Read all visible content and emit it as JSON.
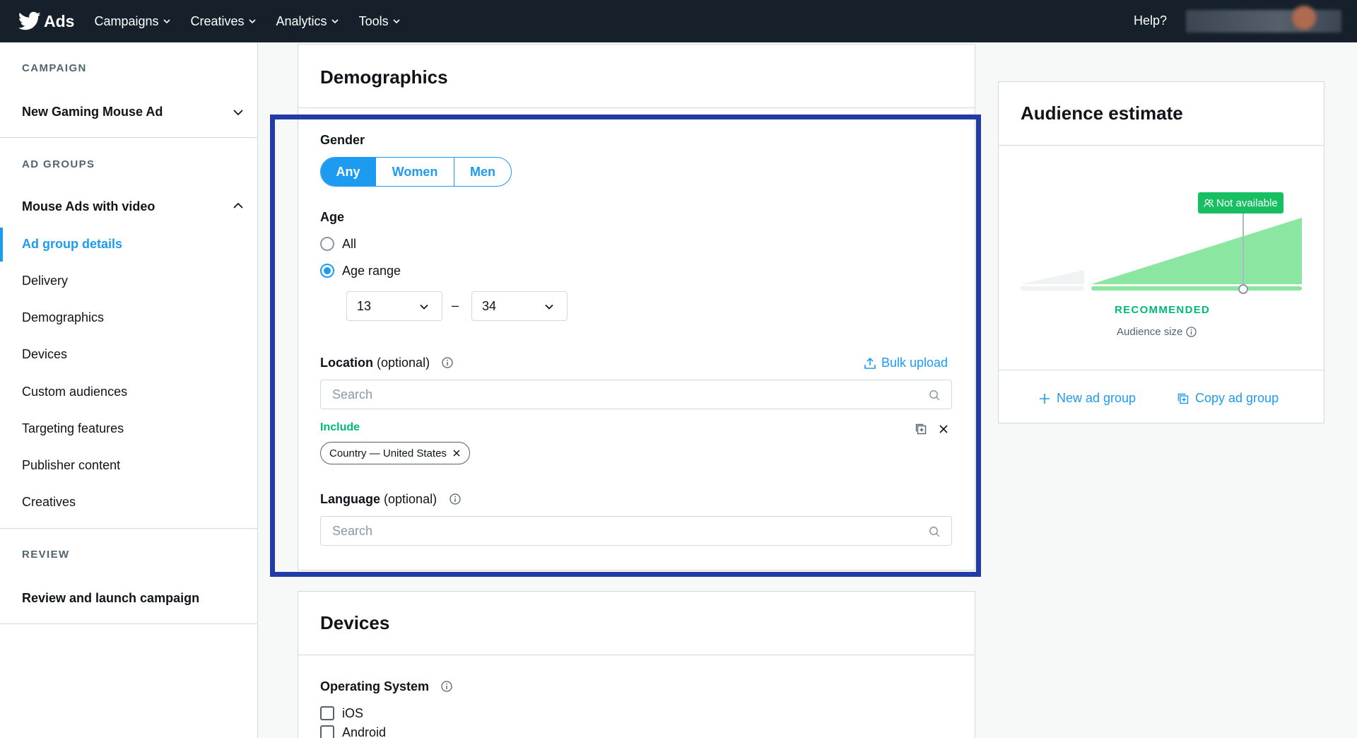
{
  "topnav": {
    "brand": "Ads",
    "menu": [
      {
        "label": "Campaigns"
      },
      {
        "label": "Creatives"
      },
      {
        "label": "Analytics"
      },
      {
        "label": "Tools"
      }
    ],
    "help": "Help?"
  },
  "sidebar": {
    "campaign_label": "CAMPAIGN",
    "campaign_name": "New Gaming Mouse Ad",
    "ad_groups_label": "AD GROUPS",
    "ad_group_name": "Mouse Ads with video",
    "items": [
      {
        "label": "Ad group details"
      },
      {
        "label": "Delivery"
      },
      {
        "label": "Demographics"
      },
      {
        "label": "Devices"
      },
      {
        "label": "Custom audiences"
      },
      {
        "label": "Targeting features"
      },
      {
        "label": "Publisher content"
      },
      {
        "label": "Creatives"
      }
    ],
    "review_label": "REVIEW",
    "review_item": "Review and launch campaign"
  },
  "demographics": {
    "title": "Demographics",
    "gender_label": "Gender",
    "gender_options": [
      "Any",
      "Women",
      "Men"
    ],
    "gender_selected": "Any",
    "age_label": "Age",
    "age_all": "All",
    "age_range": "Age range",
    "age_from": "13",
    "age_dash": "–",
    "age_to": "34",
    "location_label": "Location",
    "location_optional": "(optional)",
    "bulk_upload": "Bulk upload",
    "location_placeholder": "Search",
    "include_label": "Include",
    "chip": "Country — United States",
    "language_label": "Language",
    "language_optional": "(optional)",
    "language_placeholder": "Search"
  },
  "devices": {
    "title": "Devices",
    "os_label": "Operating System",
    "os_options": [
      "iOS",
      "Android"
    ]
  },
  "audience": {
    "title": "Audience estimate",
    "badge": "Not available",
    "recommended": "RECOMMENDED",
    "size_label": "Audience size",
    "new_ad_group": "New ad group",
    "copy_ad_group": "Copy ad group"
  },
  "colors": {
    "accent": "#1d9bf0",
    "nav_bg": "#15202b",
    "green": "#00ba7c",
    "chart_green": "#8ae6a0",
    "highlight": "#233ba6"
  }
}
